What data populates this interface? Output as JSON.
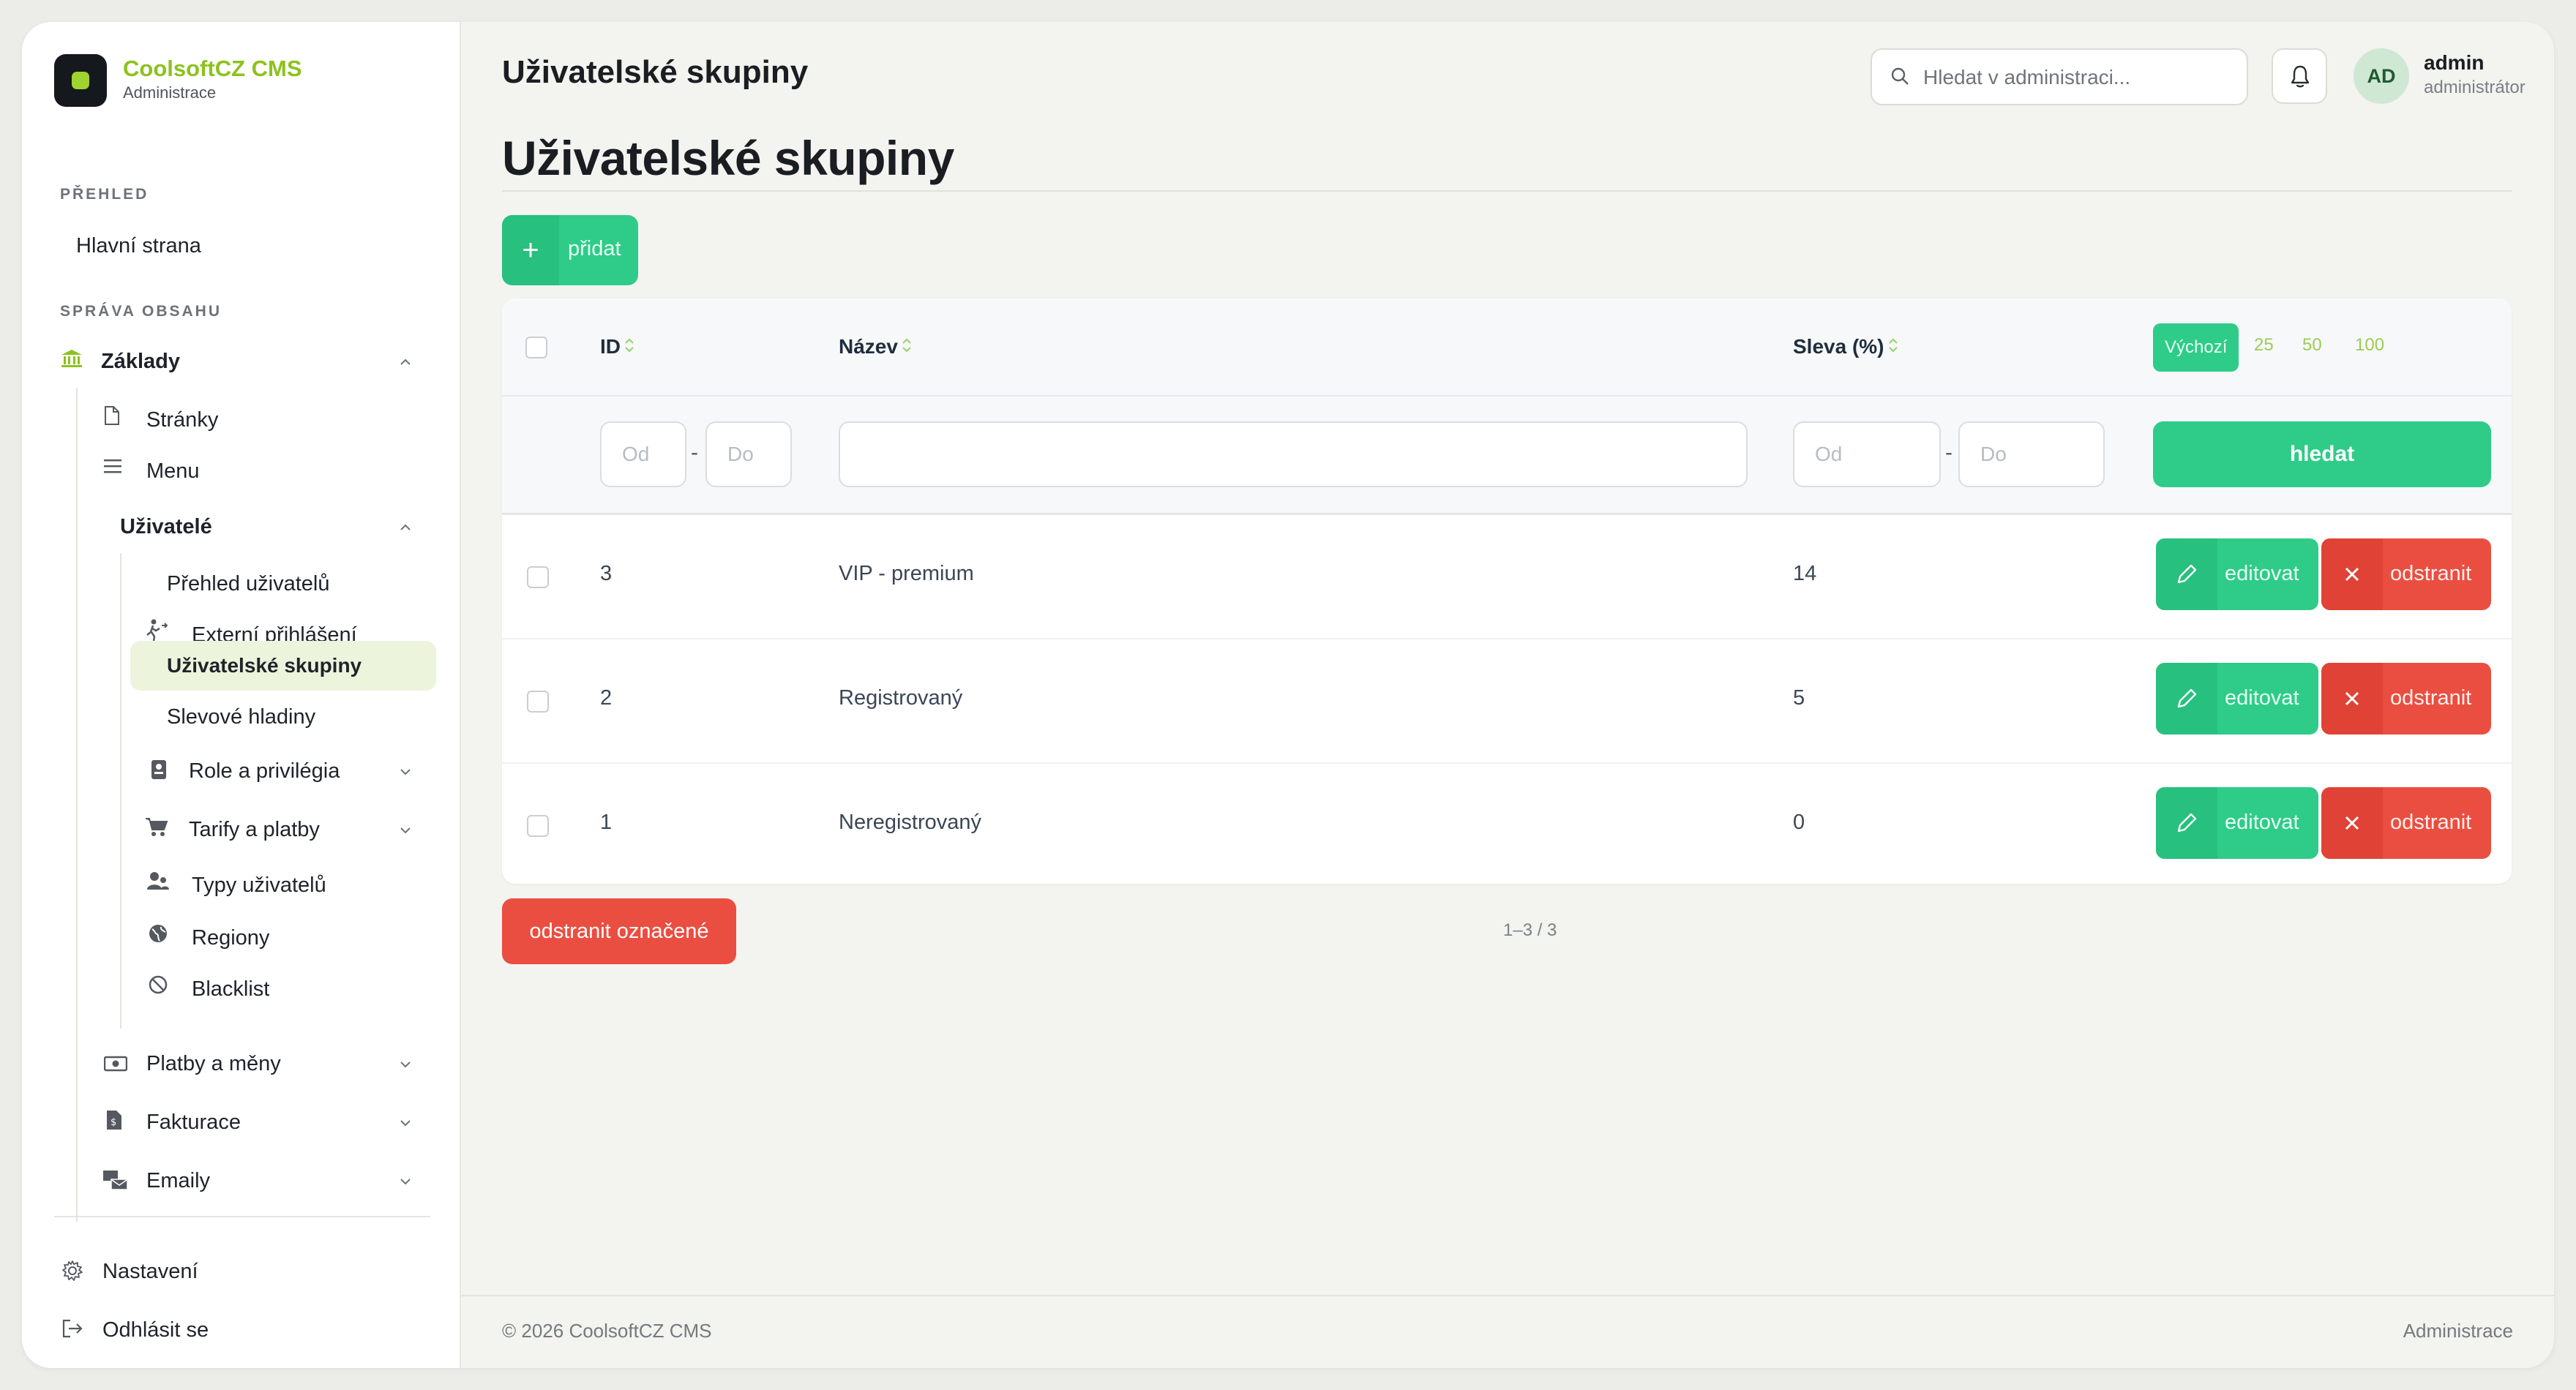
{
  "brand": {
    "title": "CoolsoftCZ CMS",
    "subtitle": "Administrace"
  },
  "sidebar": {
    "sections": {
      "overview": "PŘEHLED",
      "content": "SPRÁVA OBSAHU"
    },
    "home": "Hlavní strana",
    "zaklady": "Základy",
    "stranky": "Stránky",
    "menu": "Menu",
    "uzivatele": "Uživatelé",
    "prehled_uzivatelu": "Přehled uživatelů",
    "externi_prihlaseni": "Externí přihlášení",
    "uzivatelske_skupiny": "Uživatelské skupiny",
    "slevove_hladiny": "Slevové hladiny",
    "role": "Role a privilégia",
    "tarify": "Tarify a platby",
    "typy": "Typy uživatelů",
    "regiony": "Regiony",
    "blacklist": "Blacklist",
    "platby": "Platby a měny",
    "fakturace": "Fakturace",
    "emaily": "Emaily",
    "nastaveni": "Nastavení",
    "odhlasit": "Odhlásit se"
  },
  "header": {
    "title": "Uživatelské skupiny",
    "search_placeholder": "Hledat v administraci...",
    "user": {
      "initials": "AD",
      "name": "admin",
      "role": "administrátor"
    }
  },
  "page": {
    "title": "Uživatelské skupiny",
    "add_label": "přidat",
    "columns": {
      "id": "ID",
      "name": "Název",
      "discount": "Sleva (%)"
    },
    "per_page": [
      "Výchozí",
      "25",
      "50",
      "100"
    ],
    "filter": {
      "from": "Od",
      "to": "Do",
      "dash": "-",
      "search_label": "hledat"
    },
    "rows": [
      {
        "id": "3",
        "name": "VIP - premium",
        "discount": "14"
      },
      {
        "id": "2",
        "name": "Registrovaný",
        "discount": "5"
      },
      {
        "id": "1",
        "name": "Neregistrovaný",
        "discount": "0"
      }
    ],
    "row_actions": {
      "edit": "editovat",
      "delete": "odstranit"
    },
    "bulk_delete": "odstranit označené",
    "pagination": "1–3 / 3"
  },
  "footer": {
    "copyright": "© 2026 CoolsoftCZ CMS",
    "right": "Administrace"
  },
  "colors": {
    "accent": "#2ecc88",
    "danger": "#ea4e40",
    "brand": "#8cc21e"
  }
}
